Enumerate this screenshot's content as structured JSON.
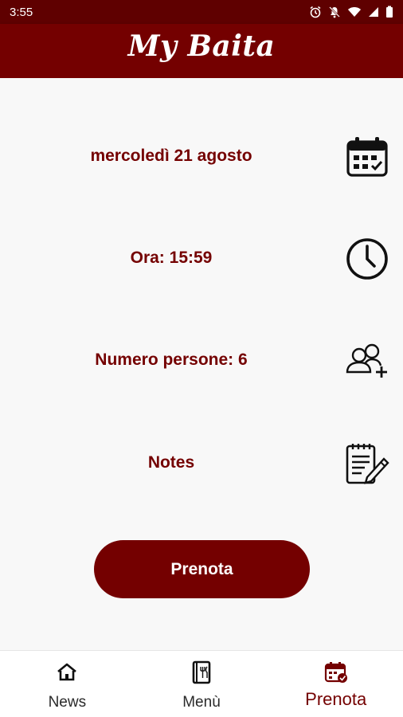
{
  "status_bar": {
    "time": "3:55",
    "icons": [
      "alarm-icon",
      "notifications-off-icon",
      "wifi-icon",
      "signal-icon",
      "battery-icon"
    ]
  },
  "app_bar": {
    "title": "My Baita"
  },
  "booking": {
    "date_label": "mercoledì 21 agosto",
    "time_label": "Ora: 15:59",
    "people_label": "Numero persone: 6",
    "notes_label": "Notes",
    "submit_label": "Prenota"
  },
  "bottom_nav": {
    "items": [
      {
        "label": "News",
        "icon": "home-icon"
      },
      {
        "label": "Menù",
        "icon": "menu-book-icon"
      },
      {
        "label": "Prenota",
        "icon": "calendar-icon",
        "active": true
      }
    ]
  },
  "colors": {
    "brand": "#740000",
    "status_bar": "#5f0000",
    "background": "#f8f8f8",
    "nav_background": "#ffffff"
  }
}
